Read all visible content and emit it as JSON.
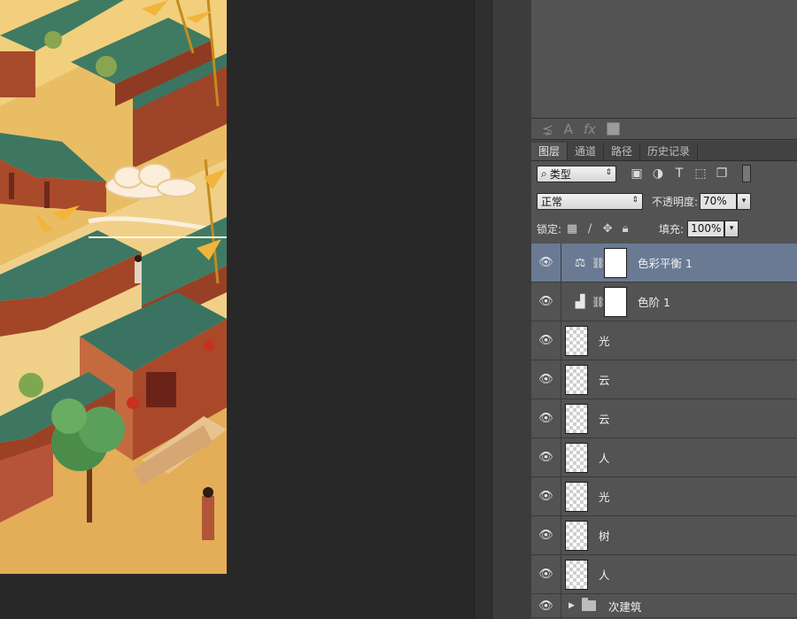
{
  "char_toolbar": {
    "icons": [
      "warp-text-icon",
      "character-icon",
      "fx-icon",
      "color-swatch"
    ],
    "glyphs": {
      "warp": "⋨",
      "char": "A",
      "fx": "fx"
    }
  },
  "layers_panel": {
    "tabs": [
      {
        "label": "图层",
        "active": true
      },
      {
        "label": "通道",
        "active": false
      },
      {
        "label": "路径",
        "active": false
      },
      {
        "label": "历史记录",
        "active": false
      }
    ],
    "filter": {
      "kind_label": "类型",
      "search_glyph": "⌕"
    },
    "blend_mode": "正常",
    "opacity_label": "不透明度:",
    "opacity_value": "70%",
    "lock_label": "锁定:",
    "fill_label": "填充:",
    "fill_value": "100%"
  },
  "layers": [
    {
      "name": "色彩平衡 1",
      "type": "adjustment",
      "icon": "color-balance-icon",
      "selected": true
    },
    {
      "name": "色阶 1",
      "type": "adjustment",
      "icon": "levels-icon",
      "selected": false
    },
    {
      "name": "光",
      "type": "pixel",
      "selected": false
    },
    {
      "name": "云",
      "type": "pixel",
      "selected": false
    },
    {
      "name": "云",
      "type": "pixel",
      "selected": false
    },
    {
      "name": "人",
      "type": "pixel",
      "selected": false
    },
    {
      "name": "光",
      "type": "pixel",
      "selected": false
    },
    {
      "name": "树",
      "type": "pixel",
      "selected": false
    },
    {
      "name": "人",
      "type": "pixel",
      "selected": false
    },
    {
      "name": "次建筑",
      "type": "group",
      "selected": false
    }
  ],
  "colors": {
    "panel_bg": "#535353",
    "selected_row": "#6a7a93",
    "canvas_bg": "#282828",
    "roof_green": "#3f7a63",
    "wall_red": "#9a3b24",
    "ground_yellow": "#e6b85f"
  }
}
